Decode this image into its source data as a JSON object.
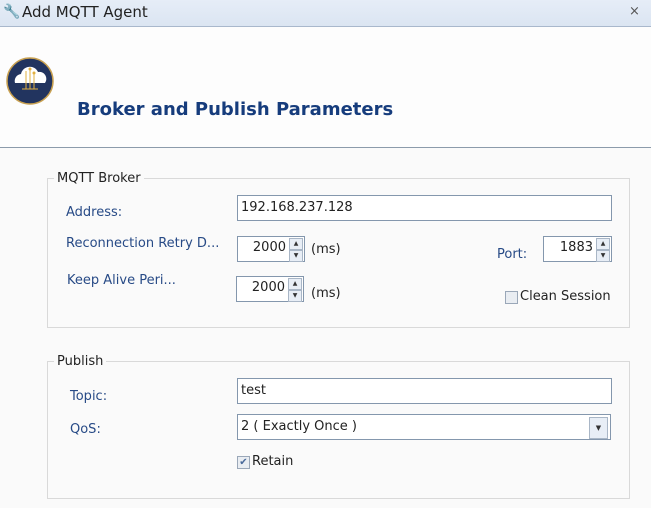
{
  "window": {
    "title": "Add MQTT Agent",
    "close": "×",
    "icon": "wrench-icon"
  },
  "header": {
    "title": "Broker and Publish Parameters",
    "logo": "cloud-circuit-logo"
  },
  "broker": {
    "legend": "MQTT Broker",
    "address_label": "Address:",
    "address_value": "192.168.237.128",
    "retry_label": "Reconnection Retry D...",
    "retry_value": "2000",
    "retry_unit": "(ms)",
    "port_label": "Port:",
    "port_value": "1883",
    "keepalive_label": "Keep Alive Peri...",
    "keepalive_value": "2000",
    "keepalive_unit": "(ms)",
    "clean_session_label": "Clean Session",
    "clean_session_checked": false
  },
  "publish": {
    "legend": "Publish",
    "topic_label": "Topic:",
    "topic_value": "test",
    "qos_label": "QoS:",
    "qos_value": "2 ( Exactly Once )",
    "retain_label": "Retain",
    "retain_checked": true
  },
  "colors": {
    "heading": "#163c7c",
    "label": "#274a86"
  }
}
